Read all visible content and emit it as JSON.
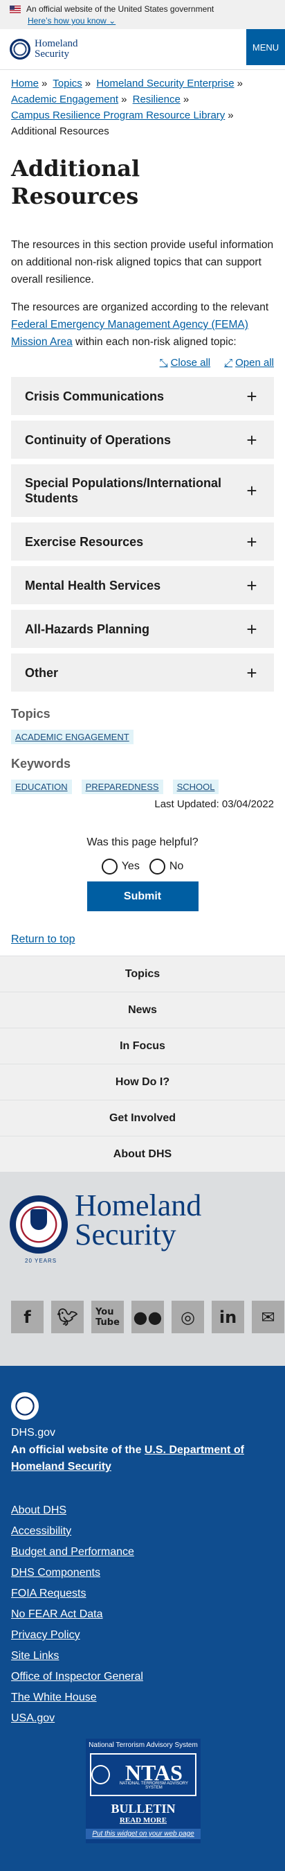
{
  "gov_banner": {
    "text": "An official website of the United States government",
    "link": "Here’s how you know"
  },
  "header": {
    "logo_line1": "Homeland",
    "logo_line2": "Security",
    "menu_label": "MENU"
  },
  "breadcrumb": {
    "items": [
      "Home",
      "Topics",
      "Homeland Security Enterprise",
      "Academic Engagement",
      "Resilience",
      "Campus Resilience Program Resource Library"
    ],
    "current": "Additional Resources"
  },
  "page_title": "Additional Resources",
  "intro": {
    "p1": "The resources in this section provide useful information on additional non-risk aligned topics that can support overall resilience.",
    "p2_before": "The resources are organized according to the relevant ",
    "p2_link": "Federal Emergency Management Agency (FEMA) Mission Area",
    "p2_after": " within each non-risk aligned topic:"
  },
  "accordion_controls": {
    "close_all": "Close all",
    "open_all": "Open all"
  },
  "accordion": [
    "Crisis Communications",
    "Continuity of Operations",
    "Special Populations/International Students",
    "Exercise Resources",
    "Mental Health Services",
    "All-Hazards Planning",
    "Other"
  ],
  "topics": {
    "heading": "Topics",
    "tags": [
      "ACADEMIC ENGAGEMENT"
    ]
  },
  "keywords": {
    "heading": "Keywords",
    "tags": [
      "EDUCATION",
      "PREPAREDNESS",
      "SCHOOL"
    ]
  },
  "last_updated": "Last Updated: 03/04/2022",
  "feedback": {
    "question": "Was this page helpful?",
    "yes": "Yes",
    "no": "No",
    "submit": "Submit"
  },
  "return_to_top": "Return to top",
  "footer_nav": [
    "Topics",
    "News",
    "In Focus",
    "How Do I?",
    "Get Involved",
    "About DHS"
  ],
  "footer_brand": {
    "line1": "Homeland",
    "line2": "Security",
    "years": "20 YEARS"
  },
  "social_icons": [
    "facebook-icon",
    "twitter-icon",
    "youtube-icon",
    "flickr-icon",
    "instagram-icon",
    "linkedin-icon",
    "email-icon"
  ],
  "footer_dark": {
    "domain": "DHS.gov",
    "official_prefix": "An official website of the ",
    "official_link": "U.S. Department of Homeland Security",
    "links": [
      "About DHS",
      "Accessibility",
      "Budget and Performance",
      "DHS Components",
      "FOIA Requests",
      "No FEAR Act Data",
      "Privacy Policy",
      "Site Links",
      "Office of Inspector General",
      "The White House",
      "USA.gov"
    ]
  },
  "ntas": {
    "title": "National Terrorism Advisory System",
    "word": "NTAS",
    "subtitle": "NATIONAL TERRORISM ADVISORY SYSTEM",
    "bulletin": "BULLETIN",
    "read_more": "READ MORE",
    "widget": "Put this widget on your web page"
  }
}
